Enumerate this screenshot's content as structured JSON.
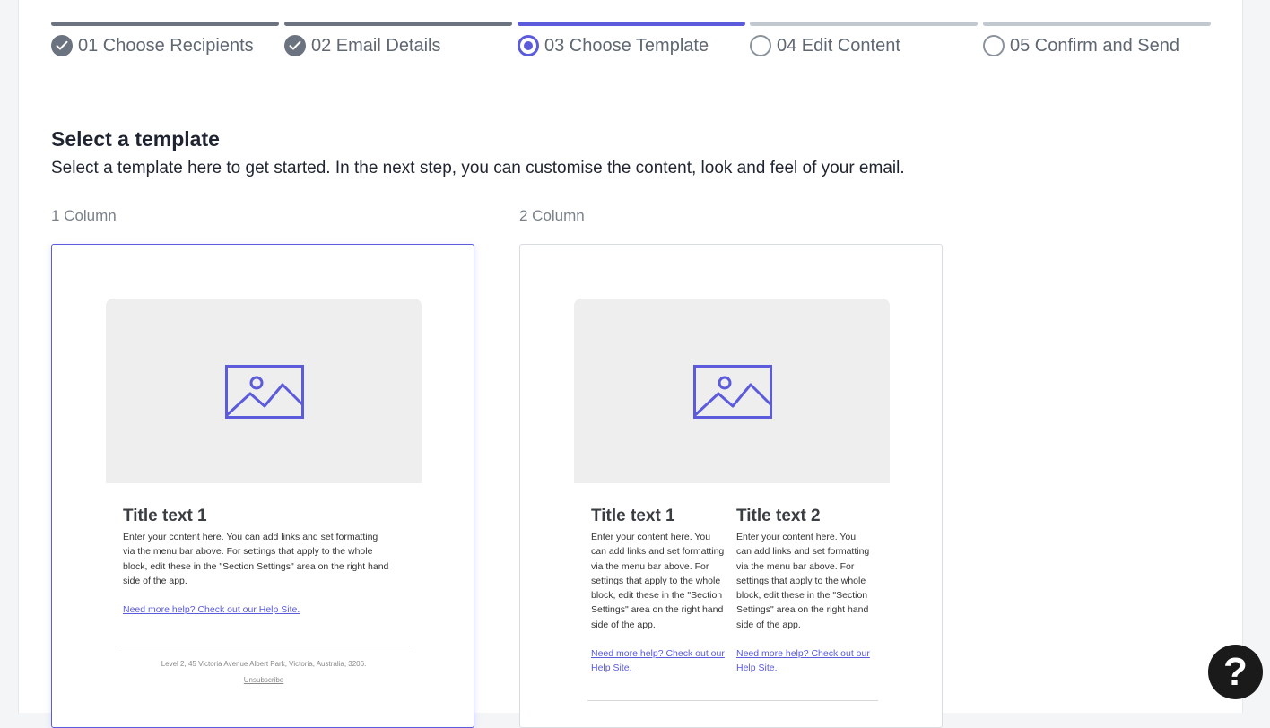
{
  "stepper": {
    "steps": [
      {
        "label": "01 Choose Recipients",
        "state": "done"
      },
      {
        "label": "02 Email Details",
        "state": "done"
      },
      {
        "label": "03 Choose Template",
        "state": "active"
      },
      {
        "label": "04 Edit Content",
        "state": "todo"
      },
      {
        "label": "05 Confirm and Send",
        "state": "todo"
      }
    ]
  },
  "main": {
    "title": "Select a template",
    "subtitle": "Select a template here to get started. In the next step, you can customise the content, look and feel of your email."
  },
  "templates": [
    {
      "label": "1 Column",
      "selected": true,
      "columns": [
        {
          "title": "Title text 1",
          "body": "Enter your content here. You can add links and set formatting via the menu bar above. For settings that apply to the whole block, edit these in the \"Section Settings\" area on the right hand side of the app.",
          "link": "Need more help? Check out our Help Site."
        }
      ],
      "footer_address": "Level 2, 45 Victoria Avenue Albert Park, Victoria, Australia, 3206.",
      "footer_unsubscribe": "Unsubscribe"
    },
    {
      "label": "2 Column",
      "selected": false,
      "columns": [
        {
          "title": "Title text 1",
          "body": "Enter your content here. You can add links and set formatting via the menu bar above. For settings that apply to the whole block, edit these in the \"Section Settings\" area on the right hand side of the app.",
          "link": "Need more help? Check out our Help Site."
        },
        {
          "title": "Title text 2",
          "body": "Enter your content here. You can add links and set formatting via the menu bar above. For settings that apply to the whole block, edit these in the \"Section Settings\" area on the right hand side of the app.",
          "link": "Need more help? Check out our Help Site."
        }
      ]
    }
  ],
  "help": {
    "glyph": "?"
  },
  "colors": {
    "accent": "#5b5bdc",
    "done": "#6b7280",
    "pending": "#c2c8d0"
  },
  "icons": {
    "done": "check-circle-icon",
    "active": "radio-selected-icon",
    "todo": "radio-empty-icon",
    "placeholder": "image-icon"
  }
}
